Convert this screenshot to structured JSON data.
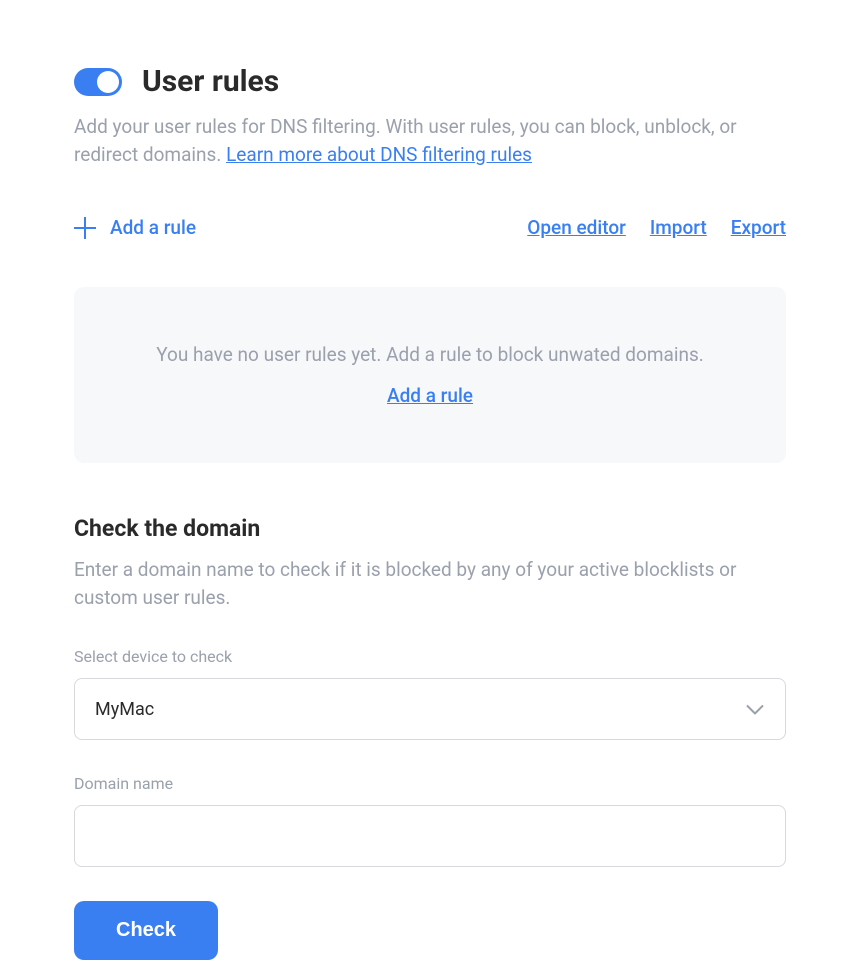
{
  "header": {
    "title": "User rules",
    "description_part1": "Add your user rules for DNS filtering. With user rules, you can block, unblock, or redirect domains. ",
    "learn_more": "Learn more about DNS filtering rules"
  },
  "actions": {
    "add_rule": "Add a rule",
    "open_editor": "Open editor",
    "import": "Import",
    "export": "Export"
  },
  "empty_state": {
    "message": "You have no user rules yet. Add a rule to block unwated domains.",
    "link": "Add a rule"
  },
  "check_domain": {
    "title": "Check the domain",
    "description": "Enter a domain name to check if it is blocked by any of your active blocklists or custom user rules.",
    "device_label": "Select device to check",
    "device_selected": "MyMac",
    "domain_label": "Domain name",
    "domain_value": "",
    "button": "Check"
  }
}
